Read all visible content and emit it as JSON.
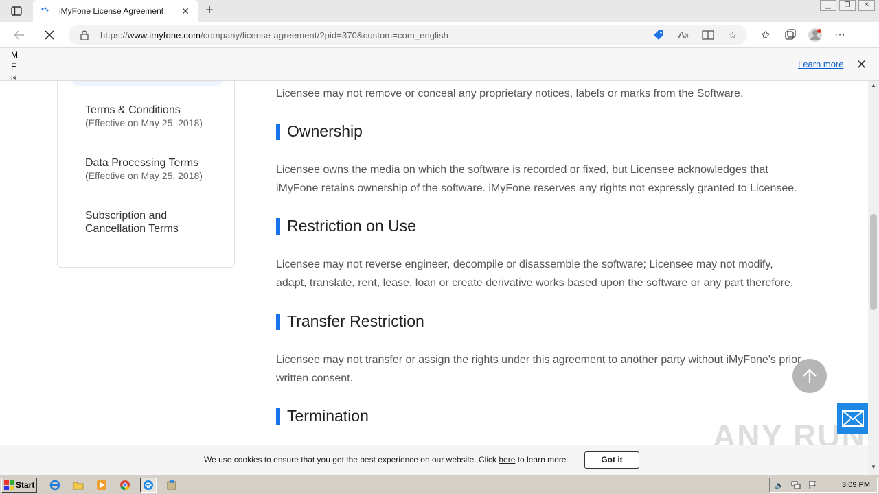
{
  "browser": {
    "tab_title": "iMyFone License Agreement",
    "url_prefix": "https://",
    "url_host": "www.imyfone.com",
    "url_path": "/company/license-agreement/?pid=370&custom=com_english"
  },
  "infobar": {
    "text": "M E is",
    "learn_more": "Learn more"
  },
  "sidebar": {
    "items": [
      {
        "title": "Terms & Conditions",
        "sub": "(Effective on May 25, 2018)"
      },
      {
        "title": "Data Processing Terms",
        "sub": "(Effective on May 25, 2018)"
      },
      {
        "title": "Subscription and Cancellation Terms",
        "sub": ""
      }
    ]
  },
  "article": {
    "intro": "Licensee may not remove or conceal any proprietary notices, labels or marks from the Software.",
    "sections": [
      {
        "heading": "Ownership",
        "text": "Licensee owns the media on which the software is recorded or fixed, but Licensee acknowledges that iMyFone retains ownership of the software. iMyFone reserves any rights not expressly granted to Licensee."
      },
      {
        "heading": "Restriction on Use",
        "text": "Licensee may not reverse engineer, decompile or disassemble the software; Licensee may not modify, adapt, translate, rent, lease, loan or create derivative works based upon the software or any part therefore."
      },
      {
        "heading": "Transfer Restriction",
        "text": "Licensee may not transfer or assign the rights under this agreement to another party without iMyFone's prior written consent."
      },
      {
        "heading": "Termination",
        "text": ""
      }
    ]
  },
  "cookie": {
    "text_before": "We use cookies to ensure that you get the best experience on our website. Click ",
    "link": "here",
    "text_after": " to learn more.",
    "button": "Got it"
  },
  "watermark": "ANY RUN",
  "taskbar": {
    "start": "Start",
    "clock": "3:09 PM"
  },
  "colors": {
    "accent": "#1a73e8",
    "mail_button": "#1e88e5",
    "link": "#0b5fcf"
  }
}
